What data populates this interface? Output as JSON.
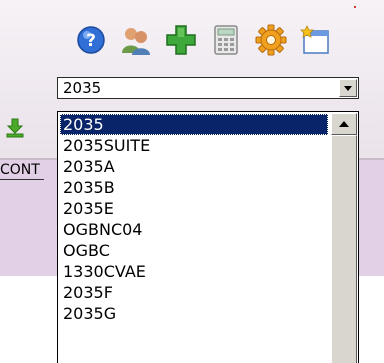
{
  "toolbar": {
    "icons": [
      "help-icon",
      "users-icon",
      "add-icon",
      "calculator-icon",
      "settings-icon",
      "new-window-icon"
    ]
  },
  "combo": {
    "value": "2035"
  },
  "dropdown": {
    "options": [
      "2035",
      "2035SUITE",
      "2035A",
      "2035B",
      "2035E",
      "OGBNC04",
      "OGBC",
      "1330CVAE",
      "2035F",
      "2035G"
    ],
    "selected": "2035"
  },
  "background": {
    "cont_label": "CONT"
  },
  "colors": {
    "selection": "#0a246a",
    "panel": "#e1d0e6"
  }
}
